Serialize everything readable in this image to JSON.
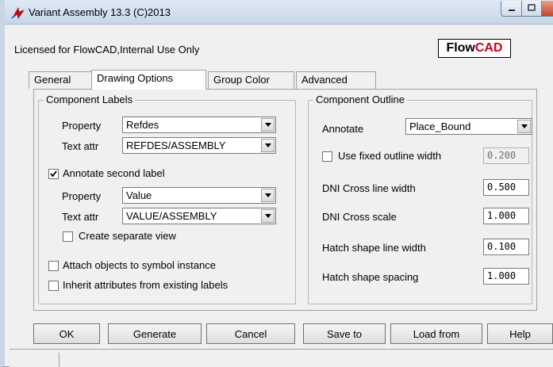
{
  "window": {
    "title": "Variant Assembly 13.3 (C)2013"
  },
  "license_text": "Licensed for FlowCAD,Internal Use Only",
  "logo": {
    "part1": "Flow",
    "part2": "CAD"
  },
  "tabs": [
    {
      "label": "General",
      "active": false
    },
    {
      "label": "Drawing Options",
      "active": true
    },
    {
      "label": "Group Color",
      "active": false
    },
    {
      "label": "Advanced",
      "active": false
    }
  ],
  "component_labels": {
    "title": "Component Labels",
    "property_label": "Property",
    "property_value": "Refdes",
    "text_attr_label": "Text attr",
    "text_attr_value": "REFDES/ASSEMBLY",
    "annotate_second_label": "Annotate second label",
    "annotate_second_checked": true,
    "property2_label": "Property",
    "property2_value": "Value",
    "text_attr2_label": "Text attr",
    "text_attr2_value": "VALUE/ASSEMBLY",
    "create_separate_view": "Create separate view",
    "attach_objects": "Attach objects to symbol instance",
    "inherit_attributes": "Inherit attributes from existing labels"
  },
  "component_outline": {
    "title": "Component Outline",
    "annotate_label": "Annotate",
    "annotate_value": "Place_Bound",
    "use_fixed_outline_width": "Use fixed outline width",
    "fixed_outline_width_value": "0.200",
    "dni_cross_line_width_label": "DNI Cross line width",
    "dni_cross_line_width_value": "0.500",
    "dni_cross_scale_label": "DNI Cross scale",
    "dni_cross_scale_value": "1.000",
    "hatch_shape_line_width_label": "Hatch shape line width",
    "hatch_shape_line_width_value": "0.100",
    "hatch_shape_spacing_label": "Hatch shape spacing",
    "hatch_shape_spacing_value": "1.000"
  },
  "buttons": {
    "ok": "OK",
    "generate": "Generate",
    "cancel": "Cancel",
    "save_to": "Save to",
    "load_from": "Load from",
    "help": "Help"
  },
  "colors": {
    "logo_accent": "#d0021b",
    "title_gradient_top": "#dfe9f5",
    "close_button": "#c7432a"
  },
  "icons": {
    "app": "variant-assembly-icon",
    "minimize": "minimize-icon",
    "maximize": "maximize-icon",
    "close": "close-icon"
  }
}
